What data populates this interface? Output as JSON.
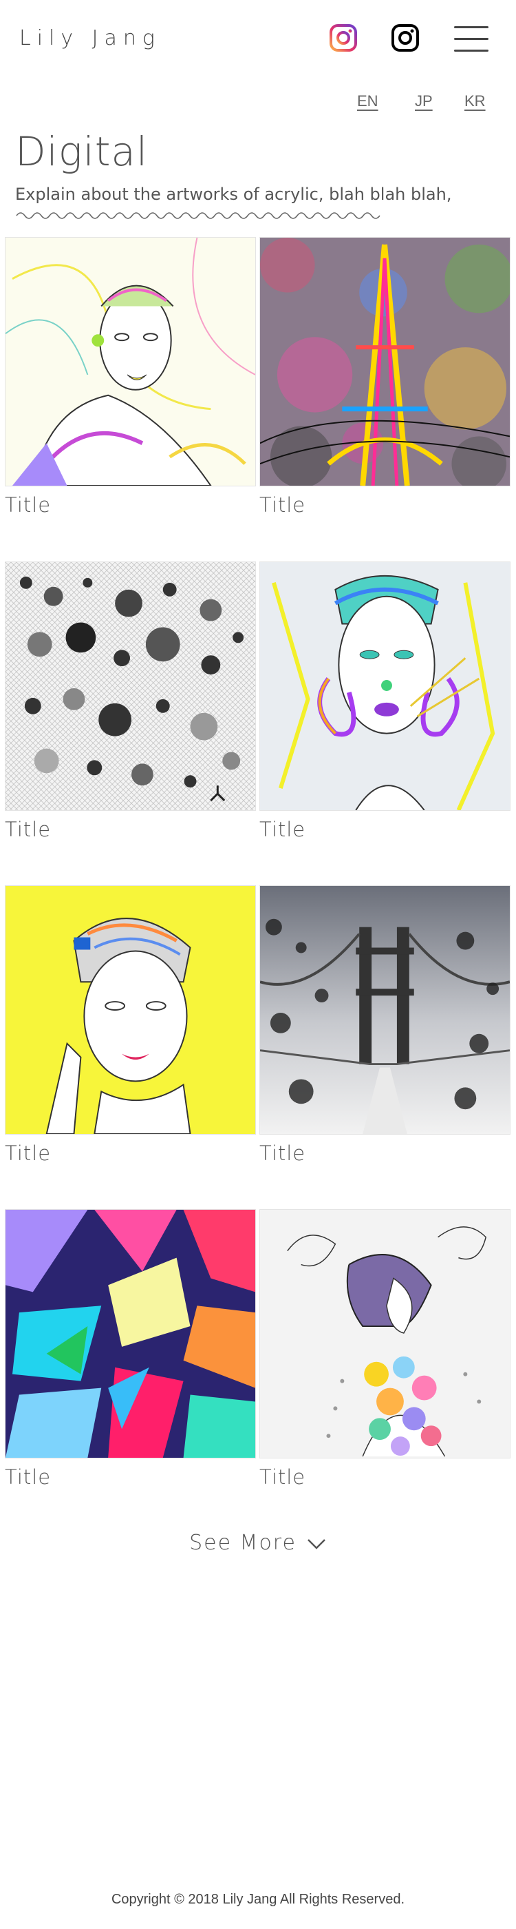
{
  "header": {
    "logo": "Lily Jang",
    "icons": [
      "instagram-color-icon",
      "instagram-icon",
      "hamburger-menu-icon"
    ]
  },
  "languages": [
    "EN",
    "JP",
    "KR"
  ],
  "page": {
    "title": "Digital",
    "subtitle": "Explain about the artworks of acrylic, blah blah blah,"
  },
  "gallery": [
    {
      "title": "Title",
      "subject": "pop-portrait-pink-shirt"
    },
    {
      "title": "Title",
      "subject": "eiffel-tower-bokeh"
    },
    {
      "title": "Title",
      "subject": "grayscale-dot-pattern"
    },
    {
      "title": "Title",
      "subject": "green-hair-portrait"
    },
    {
      "title": "Title",
      "subject": "yellow-background-portrait"
    },
    {
      "title": "Title",
      "subject": "bridge-mist"
    },
    {
      "title": "Title",
      "subject": "stained-glass-abstract"
    },
    {
      "title": "Title",
      "subject": "flower-girl-sketch"
    }
  ],
  "see_more": "See More",
  "footer": {
    "copyright": "Copyright © 2018 Lily Jang All Rights Reserved."
  },
  "colors": {
    "text": "#555555",
    "background": "#ffffff"
  }
}
